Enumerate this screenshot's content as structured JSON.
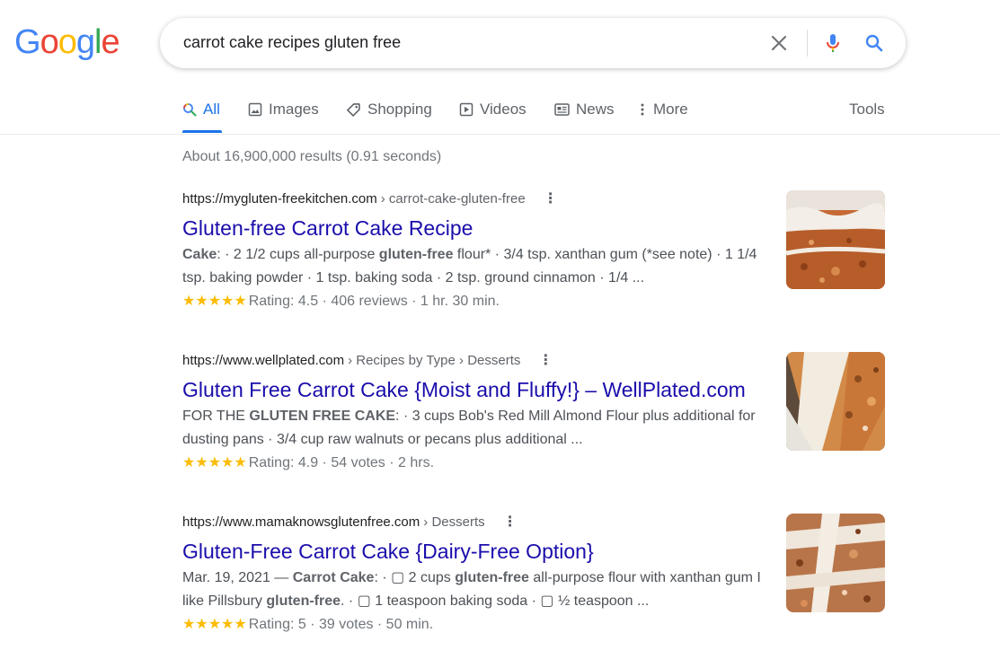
{
  "logo": {
    "letters": [
      "G",
      "o",
      "o",
      "g",
      "l",
      "e"
    ],
    "colors": [
      "#4285f4",
      "#ea4335",
      "#fbbc05",
      "#4285f4",
      "#34a853",
      "#ea4335"
    ]
  },
  "search": {
    "query": "carrot cake recipes gluten free"
  },
  "tabs": [
    {
      "label": "All",
      "icon": "search-icon"
    },
    {
      "label": "Images",
      "icon": "image-icon"
    },
    {
      "label": "Shopping",
      "icon": "tag-icon"
    },
    {
      "label": "Videos",
      "icon": "play-icon"
    },
    {
      "label": "News",
      "icon": "newspaper-icon"
    },
    {
      "label": "More",
      "icon": "more-vert-icon"
    }
  ],
  "tools_label": "Tools",
  "stats": "About 16,900,000 results (0.91 seconds)",
  "results": [
    {
      "domain": "https://mygluten-freekitchen.com",
      "path": "› carrot-cake-gluten-free",
      "title": "Gluten-free Carrot Cake Recipe",
      "snippet_html": "<b>Cake</b>: · 2 1/2 cups all-purpose <b>gluten-free</b> flour* · 3/4 tsp. xanthan gum (*see note) · 1 1/4 tsp. baking powder · 1 tsp. baking soda · 2 tsp. ground cinnamon · 1/4 ...",
      "stars": "★★★★★",
      "rating": "Rating: 4.5 · 406 reviews · 1 hr. 30 min."
    },
    {
      "domain": "https://www.wellplated.com",
      "path": "› Recipes by Type › Desserts",
      "title": "Gluten Free Carrot Cake {Moist and Fluffy!} – WellPlated.com",
      "snippet_html": "FOR THE <b>GLUTEN FREE CAKE</b>: · 3 cups Bob's Red Mill Almond Flour plus additional for dusting pans · 3/4 cup raw walnuts or pecans plus additional ...",
      "stars": "★★★★★",
      "rating": "Rating: 4.9 · 54 votes · 2 hrs."
    },
    {
      "domain": "https://www.mamaknowsglutenfree.com",
      "path": "› Desserts",
      "title": "Gluten-Free Carrot Cake {Dairy-Free Option}",
      "snippet_html": "Mar. 19, 2021 — <b>Carrot Cake</b>: · ▢ 2 cups <b>gluten-free</b> all-purpose flour with xanthan gum I like Pillsbury <b>gluten-free</b>. · ▢ 1 teaspoon baking soda · ▢ ½ teaspoon ...",
      "stars": "★★★★★",
      "rating": "Rating: 5 · 39 votes · 50 min."
    }
  ],
  "colors": {
    "link": "#1a0dab",
    "accent": "#1a73e8",
    "star": "#fbbc04"
  }
}
